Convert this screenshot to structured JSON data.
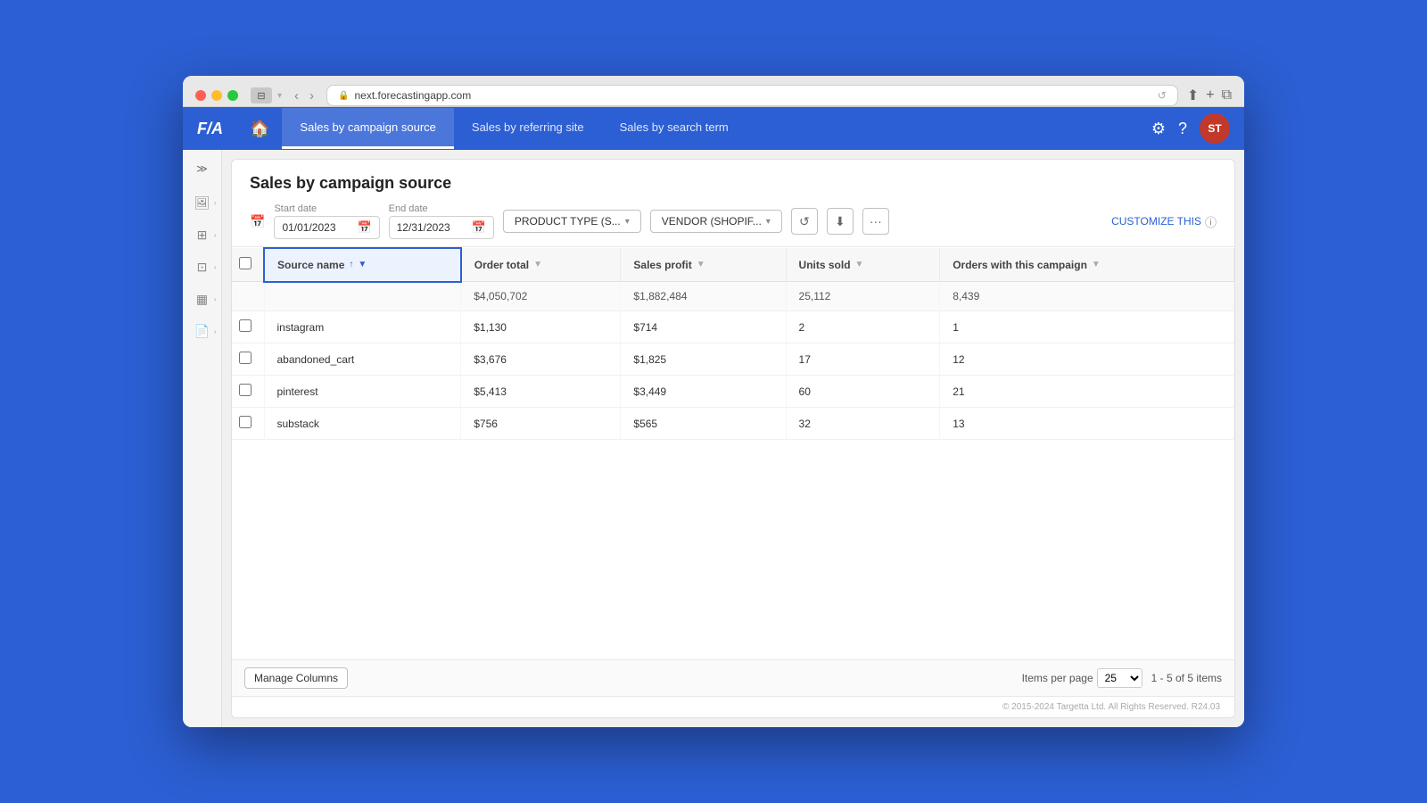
{
  "browser": {
    "url": "next.forecastingapp.com",
    "reload_icon": "↺"
  },
  "app": {
    "logo": "F/A",
    "nav_tabs": [
      {
        "id": "campaign",
        "label": "Sales by campaign source",
        "active": true
      },
      {
        "id": "referring",
        "label": "Sales by referring site",
        "active": false
      },
      {
        "id": "search",
        "label": "Sales by search term",
        "active": false
      }
    ],
    "avatar_initials": "ST"
  },
  "page": {
    "title": "Sales by campaign source",
    "start_date_label": "Start date",
    "start_date_value": "01/01/2023",
    "end_date_label": "End date",
    "end_date_value": "12/31/2023",
    "filter_product": "PRODUCT TYPE (S...",
    "filter_vendor": "VENDOR (SHOPIF...",
    "customize_label": "CUSTOMIZE THIS"
  },
  "table": {
    "columns": [
      {
        "id": "source_name",
        "label": "Source name",
        "sorted": true,
        "active": true
      },
      {
        "id": "order_total",
        "label": "Order total",
        "sorted": false,
        "active": false
      },
      {
        "id": "sales_profit",
        "label": "Sales profit",
        "sorted": false,
        "active": false
      },
      {
        "id": "units_sold",
        "label": "Units sold",
        "sorted": false,
        "active": false
      },
      {
        "id": "orders_campaign",
        "label": "Orders with this campaign",
        "sorted": false,
        "active": false
      }
    ],
    "totals": {
      "source_name": "",
      "order_total": "$4,050,702",
      "sales_profit": "$1,882,484",
      "units_sold": "25,112",
      "orders_campaign": "8,439"
    },
    "rows": [
      {
        "source_name": "instagram",
        "order_total": "$1,130",
        "sales_profit": "$714",
        "units_sold": "2",
        "orders_campaign": "1"
      },
      {
        "source_name": "abandoned_cart",
        "order_total": "$3,676",
        "sales_profit": "$1,825",
        "units_sold": "17",
        "orders_campaign": "12"
      },
      {
        "source_name": "pinterest",
        "order_total": "$5,413",
        "sales_profit": "$3,449",
        "units_sold": "60",
        "orders_campaign": "21"
      },
      {
        "source_name": "substack",
        "order_total": "$756",
        "sales_profit": "$565",
        "units_sold": "32",
        "orders_campaign": "13"
      }
    ],
    "manage_columns_label": "Manage Columns",
    "items_per_page_label": "Items per page",
    "items_per_page_value": "25",
    "pagination_info": "1 - 5 of 5 items"
  },
  "footer": {
    "copyright": "© 2015-2024 Targetta Ltd. All Rights Reserved. R24.03"
  }
}
